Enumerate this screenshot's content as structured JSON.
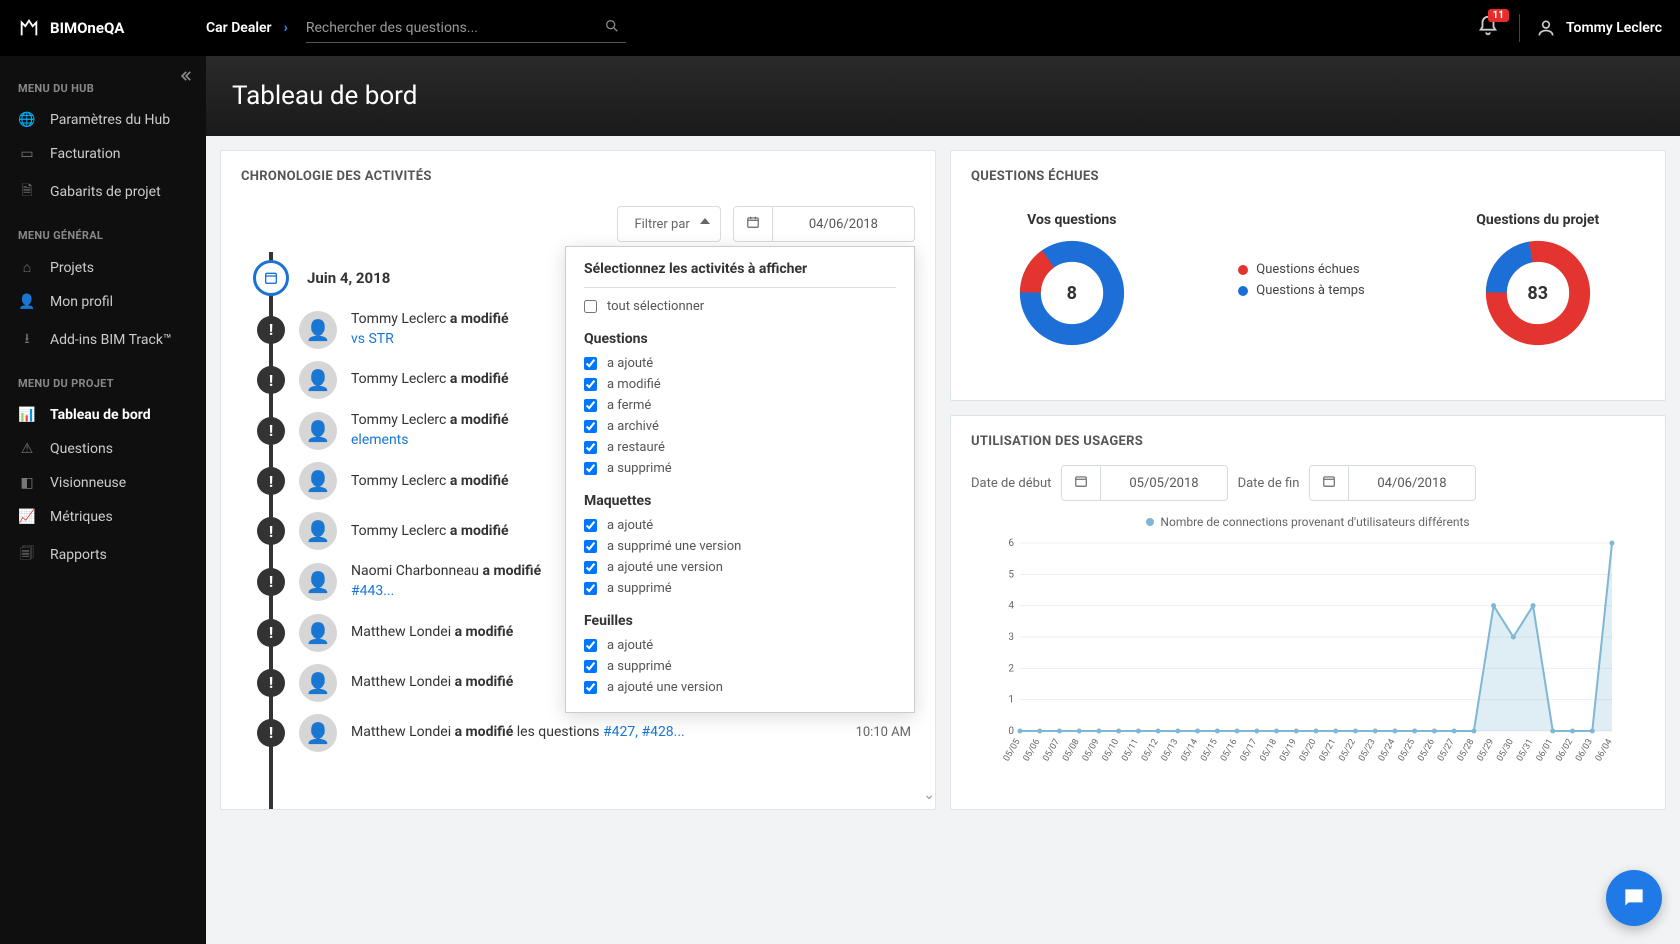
{
  "header": {
    "brand": "BIMOneQA",
    "project": "Car Dealer",
    "search_placeholder": "Rechercher des questions...",
    "notif_count": "11",
    "user_name": "Tommy Leclerc"
  },
  "sidebar": {
    "section_hub": "MENU DU HUB",
    "hub_items": [
      "Paramètres du Hub",
      "Facturation",
      "Gabarits de projet"
    ],
    "section_general": "MENU GÉNÉRAL",
    "general_items": [
      "Projets",
      "Mon profil",
      "Add-ins BIM Track™"
    ],
    "section_project": "MENU DU PROJET",
    "project_items": [
      "Tableau de bord",
      "Questions",
      "Visionneuse",
      "Métriques",
      "Rapports"
    ]
  },
  "page": {
    "title": "Tableau de bord"
  },
  "timeline": {
    "card_title": "CHRONOLOGIE DES ACTIVITÉS",
    "filter_label": "Filtrer par",
    "date_value": "04/06/2018",
    "day_label": "Juin 4, 2018",
    "items": [
      {
        "user": "Tommy Leclerc",
        "action": "a modifié",
        "link": "vs STR",
        "time": ""
      },
      {
        "user": "Tommy Leclerc",
        "action": "a modifié",
        "link": "",
        "time": ""
      },
      {
        "user": "Tommy Leclerc",
        "action": "a modifié",
        "link": "elements",
        "time": ""
      },
      {
        "user": "Tommy Leclerc",
        "action": "a modifié",
        "link": "",
        "time": ""
      },
      {
        "user": "Tommy Leclerc",
        "action": "a modifié",
        "link": "",
        "time": ""
      },
      {
        "user": "Naomi Charbonneau",
        "action": "a modifié",
        "link": "#443...",
        "time": ""
      },
      {
        "user": "Matthew Londei",
        "action": "a modifié",
        "link": "",
        "time": ""
      },
      {
        "user": "Matthew Londei",
        "action": "a modifié",
        "link": "",
        "time": ""
      },
      {
        "user": "Matthew Londei",
        "action": "a modifié",
        "suffix": " les questions ",
        "link": "#427, #428...",
        "time": "10:10 AM"
      }
    ]
  },
  "filter_popover": {
    "title": "Sélectionnez les activités à afficher",
    "select_all": "tout sélectionner",
    "groups": [
      {
        "title": "Questions",
        "items": [
          "a ajouté",
          "a modifié",
          "a fermé",
          "a archivé",
          "a restauré",
          "a supprimé"
        ]
      },
      {
        "title": "Maquettes",
        "items": [
          "a ajouté",
          "a supprimé une version",
          "a ajouté une version",
          "a supprimé"
        ]
      },
      {
        "title": "Feuilles",
        "items": [
          "a ajouté",
          "a supprimé",
          "a ajouté une version"
        ]
      }
    ]
  },
  "overdue": {
    "card_title": "QUESTIONS ÉCHUES",
    "your_title": "Vos questions",
    "project_title": "Questions du projet",
    "legend_over": "Questions échues",
    "legend_ontime": "Questions à temps",
    "your_center": "8",
    "project_center": "83"
  },
  "usage": {
    "card_title": "UTILISATION DES USAGERS",
    "start_label": "Date de début",
    "end_label": "Date de fin",
    "start_value": "05/05/2018",
    "end_value": "04/06/2018",
    "legend": "Nombre de connections provenant d'utilisateurs différents"
  },
  "chart_data": {
    "type": "line",
    "title": "Utilisation des usagers",
    "ylabel": "",
    "xlabel": "",
    "ylim": [
      0,
      6
    ],
    "categories": [
      "05/05",
      "05/06",
      "05/07",
      "05/08",
      "05/09",
      "05/10",
      "05/11",
      "05/12",
      "05/13",
      "05/14",
      "05/15",
      "05/16",
      "05/17",
      "05/18",
      "05/19",
      "05/20",
      "05/21",
      "05/22",
      "05/23",
      "05/24",
      "05/25",
      "05/26",
      "05/27",
      "05/28",
      "05/29",
      "05/30",
      "05/31",
      "06/01",
      "06/02",
      "06/03",
      "06/04"
    ],
    "series": [
      {
        "name": "Nombre de connections provenant d'utilisateurs différents",
        "values": [
          0,
          0,
          0,
          0,
          0,
          0,
          0,
          0,
          0,
          0,
          0,
          0,
          0,
          0,
          0,
          0,
          0,
          0,
          0,
          0,
          0,
          0,
          0,
          0,
          4,
          3,
          4,
          0,
          0,
          0,
          6
        ]
      }
    ],
    "donuts": [
      {
        "title": "Vos questions",
        "total": 8,
        "overdue_pct": 15,
        "ontime_pct": 85,
        "colors": {
          "overdue": "#e3342f",
          "ontime": "#1d6fd8"
        }
      },
      {
        "title": "Questions du projet",
        "total": 83,
        "overdue_pct": 78,
        "ontime_pct": 22,
        "colors": {
          "overdue": "#e3342f",
          "ontime": "#1d6fd8"
        }
      }
    ]
  }
}
